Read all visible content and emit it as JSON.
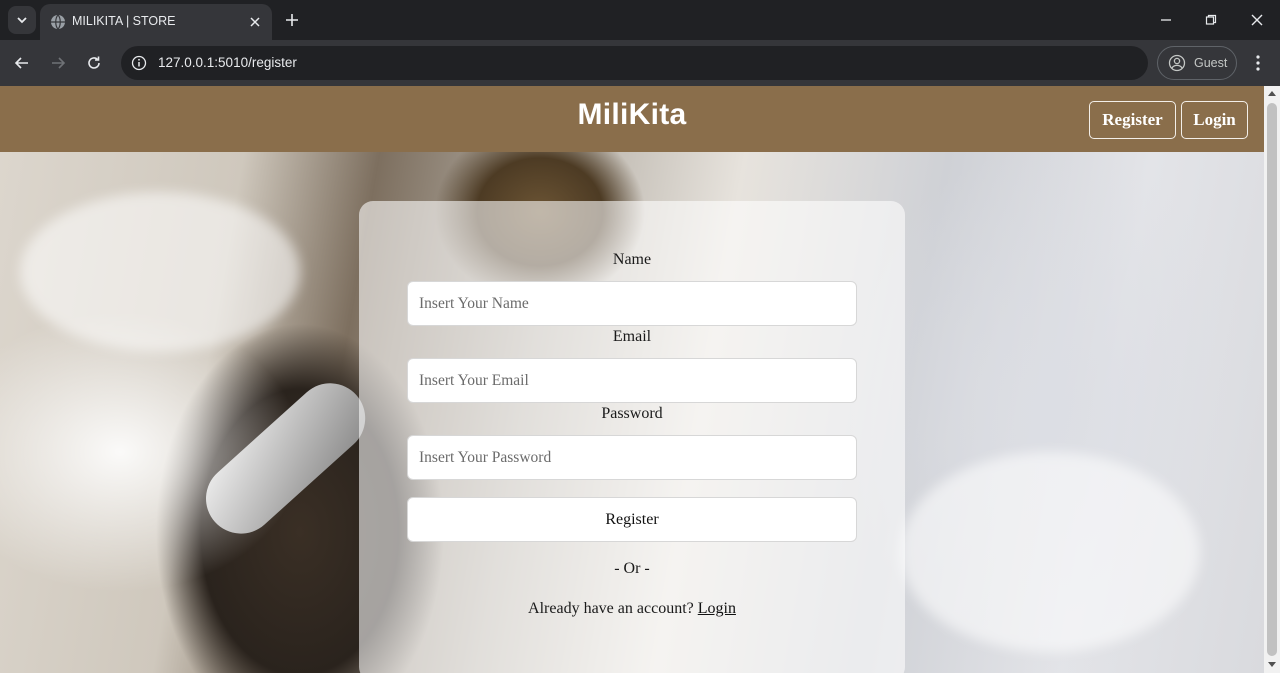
{
  "browser": {
    "tab_title": "MILIKITA | STORE",
    "url": "127.0.0.1:5010/register",
    "profile_label": "Guest"
  },
  "navbar": {
    "brand": "MiliKita",
    "register_label": "Register",
    "login_label": "Login",
    "bg_color": "#8a6e4b"
  },
  "form": {
    "name_label": "Name",
    "name_placeholder": "Insert Your Name",
    "email_label": "Email",
    "email_placeholder": "Insert Your Email",
    "password_label": "Password",
    "password_placeholder": "Insert Your Password",
    "submit_label": "Register",
    "divider": "- Or -",
    "have_account_text": "Already have an account?",
    "login_link": "Login"
  }
}
